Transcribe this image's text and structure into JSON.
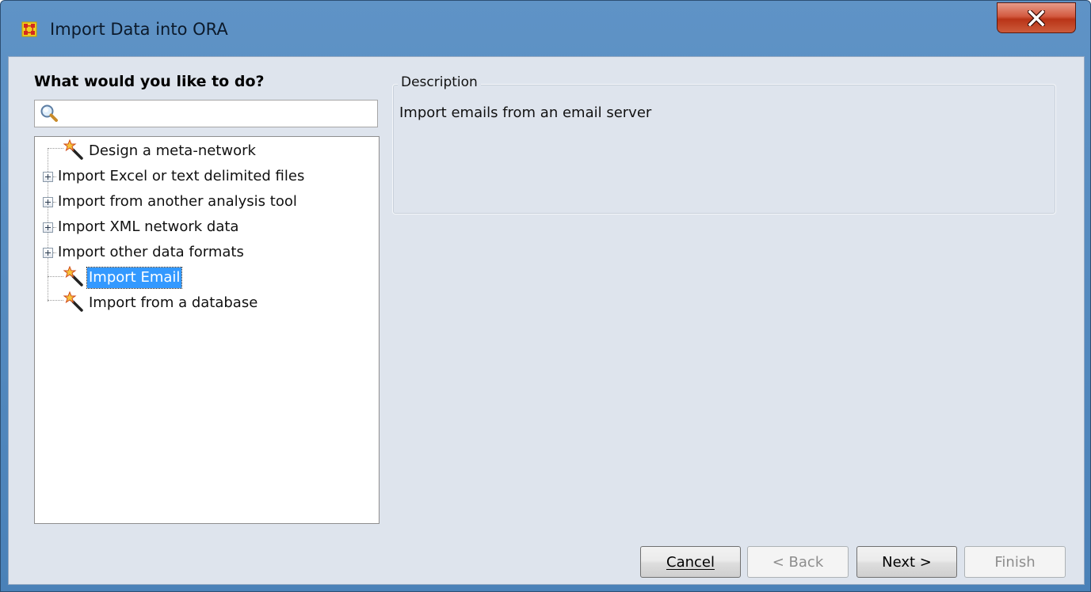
{
  "window": {
    "title": "Import Data into ORA",
    "close_label": "X"
  },
  "left_panel": {
    "heading": "What would you like to do?",
    "search": {
      "value": "",
      "placeholder": ""
    },
    "tree": [
      {
        "label": "Design a meta-network",
        "icon": "wand-icon",
        "expandable": false,
        "selected": false
      },
      {
        "label": "Import Excel or text delimited files",
        "icon": "expand-icon",
        "expandable": true,
        "selected": false
      },
      {
        "label": "Import from another analysis tool",
        "icon": "expand-icon",
        "expandable": true,
        "selected": false
      },
      {
        "label": "Import XML network data",
        "icon": "expand-icon",
        "expandable": true,
        "selected": false
      },
      {
        "label": "Import other data formats",
        "icon": "expand-icon",
        "expandable": true,
        "selected": false
      },
      {
        "label": "Import Email",
        "icon": "wand-icon",
        "expandable": false,
        "selected": true
      },
      {
        "label": "Import from a database",
        "icon": "wand-icon",
        "expandable": false,
        "selected": false
      }
    ]
  },
  "description": {
    "legend": "Description",
    "text": "Import emails from an email server"
  },
  "buttons": {
    "cancel": {
      "label": "Cancel",
      "mnemonic": "C",
      "enabled": true
    },
    "back": {
      "label": "< Back",
      "mnemonic": "B",
      "enabled": false
    },
    "next": {
      "label": "Next >",
      "mnemonic": "N",
      "enabled": true
    },
    "finish": {
      "label": "Finish",
      "mnemonic": "n",
      "enabled": false
    }
  },
  "colors": {
    "titlebar": "#4a81b8",
    "selection": "#3399ff",
    "client": "#dee4ed",
    "close": "#c8432a"
  }
}
